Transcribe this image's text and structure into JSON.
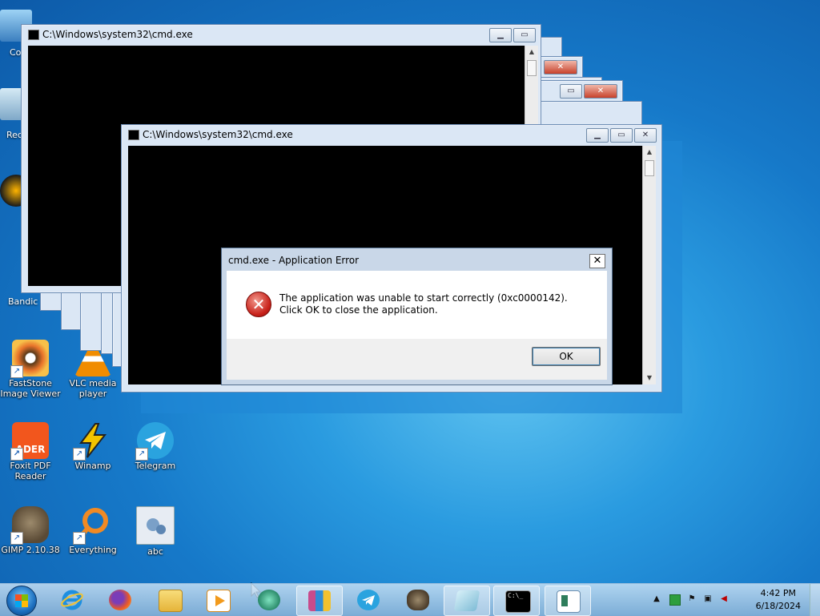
{
  "desktop": {
    "partial_icons": [
      {
        "label": "Co",
        "name": "computer-icon-partial"
      },
      {
        "label": "Rec",
        "name": "recycle-bin-icon-partial"
      },
      {
        "label": "Bandic",
        "name": "bandicam-icon-partial"
      }
    ],
    "icons": [
      {
        "label": "FastStone\nImage Viewer",
        "name": "faststone-image-viewer-icon",
        "color": "#e8742b"
      },
      {
        "label": "VLC media\nplayer",
        "name": "vlc-media-player-icon",
        "color": "#f08c00"
      },
      {
        "label": "Foxit PDF\nReader",
        "name": "foxit-pdf-reader-icon",
        "color": "#f2561d",
        "badge": "ADER"
      },
      {
        "label": "Winamp",
        "name": "winamp-icon",
        "color": "#f3c400"
      },
      {
        "label": "Telegram",
        "name": "telegram-icon",
        "color": "#2aa3df"
      },
      {
        "label": "GIMP 2.10.38",
        "name": "gimp-icon",
        "color": "#7b6a4e"
      },
      {
        "label": "Everything",
        "name": "everything-search-icon",
        "color": "#f08a24"
      },
      {
        "label": "abc",
        "name": "abc-file-icon",
        "color": "#e7ecf3"
      }
    ]
  },
  "windows": {
    "back": {
      "title": "C:\\Windows\\system32\\cmd.exe"
    },
    "front": {
      "title": "C:\\Windows\\system32\\cmd.exe"
    }
  },
  "dialog": {
    "title": "cmd.exe - Application Error",
    "close_glyph": "✕",
    "error_glyph": "✕",
    "message": "The application was unable to start correctly (0xc0000142). Click OK to close the application.",
    "ok_label": "OK"
  },
  "taskbar": {
    "items": [
      {
        "name": "taskbar-internet-explorer",
        "icon": "internet-explorer-icon",
        "color": "#1e8fe0"
      },
      {
        "name": "taskbar-firefox",
        "icon": "firefox-icon",
        "color": "#e8582a"
      },
      {
        "name": "taskbar-file-explorer",
        "icon": "folder-icon",
        "color": "#f3cf5e"
      },
      {
        "name": "taskbar-media-player",
        "icon": "media-player-icon",
        "color": "#f29a1c"
      },
      {
        "name": "taskbar-app-green",
        "icon": "green-app-icon",
        "color": "#3aa17e"
      },
      {
        "name": "taskbar-winrar",
        "icon": "winrar-icon",
        "color": "#c84b8b"
      },
      {
        "name": "taskbar-telegram",
        "icon": "telegram-icon",
        "color": "#2aa3df"
      },
      {
        "name": "taskbar-gimp",
        "icon": "gimp-icon",
        "color": "#6b5a44"
      },
      {
        "name": "taskbar-notepad",
        "icon": "notepad-icon",
        "color": "#9fd3e8"
      },
      {
        "name": "taskbar-cmd",
        "icon": "cmd-icon",
        "color": "#000000",
        "glyph": "C:\\_"
      },
      {
        "name": "taskbar-dialog",
        "icon": "window-icon",
        "color": "#dfe8ef"
      }
    ],
    "tray": {
      "show_hidden": "▲",
      "time": "4:42 PM",
      "date": "6/18/2024"
    }
  },
  "colors": {
    "desktop_blue": "#1679c9",
    "error_red": "#c8211a",
    "console_black": "#000000"
  }
}
